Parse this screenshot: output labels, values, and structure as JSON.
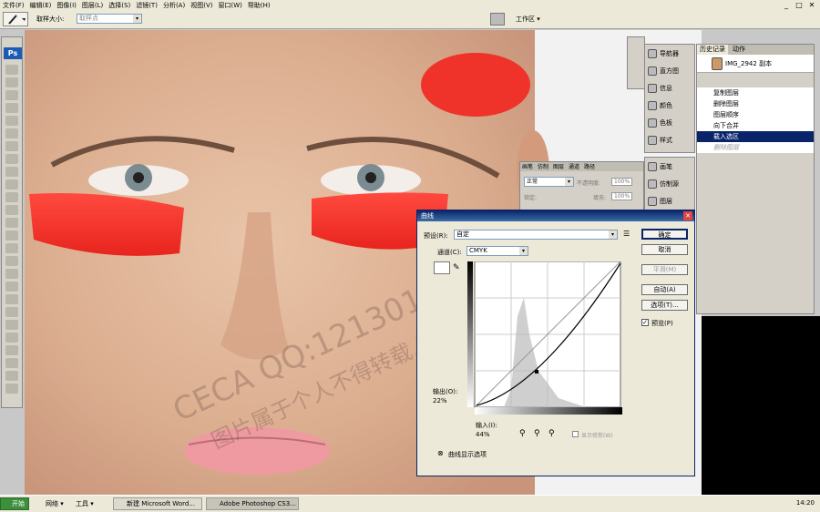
{
  "menubar": {
    "items": [
      "文件(F)",
      "编辑(E)",
      "图像(I)",
      "图层(L)",
      "选择(S)",
      "滤镜(T)",
      "分析(A)",
      "视图(V)",
      "窗口(W)",
      "帮助(H)"
    ]
  },
  "options_bar": {
    "sample_label": "取样大小:",
    "sample_value": "取样点",
    "workspace_label": "工作区 ▾"
  },
  "toolbox": {
    "ps_logo": "Ps"
  },
  "watermark": {
    "line1": "CECA QQ:121301738...",
    "line2": "图片属于个人不得转载,需转载请联系我"
  },
  "panels": {
    "dock1": [
      "导航器",
      "直方图",
      "信息",
      "颜色",
      "色板",
      "样式"
    ],
    "dock2": [
      "画笔",
      "仿制源",
      "图层"
    ],
    "history": {
      "tabs": [
        "历史记录",
        "动作"
      ],
      "snapshot": "IMG_2942 副本",
      "items": [
        "复制图层",
        "删除图层",
        "图层顺序",
        "向下合并",
        "载入选区",
        "删除图层"
      ]
    },
    "layers": {
      "tabs": [
        "画笔",
        "仿制",
        "图层",
        "通道",
        "路径"
      ],
      "mode": "正常",
      "opacity_label": "不透明度:",
      "opacity": "100%",
      "lock_label": "锁定:",
      "fill_label": "填充:",
      "fill": "100%"
    }
  },
  "curves": {
    "title": "曲线",
    "preset_label": "预设(R):",
    "preset_value": "自定",
    "channel_label": "通道(C):",
    "channel_value": "CMYK",
    "output_label": "输出(O):",
    "output_value": "22%",
    "input_label": "输入(I):",
    "input_value": "44%",
    "buttons": {
      "ok": "确定",
      "cancel": "取消",
      "smooth": "平滑(M)",
      "auto": "自动(A)",
      "options": "选项(T)..."
    },
    "preview_label": "预览(P)",
    "clipping_label": "显示修剪(W)",
    "display_options": "曲线显示选项"
  },
  "taskbar": {
    "start": "开始",
    "net": "网络 ▾",
    "tools": "工具 ▾",
    "task1": "新建 Microsoft Word...",
    "task2": "Adobe Photoshop CS3...",
    "clock": "14:20"
  }
}
